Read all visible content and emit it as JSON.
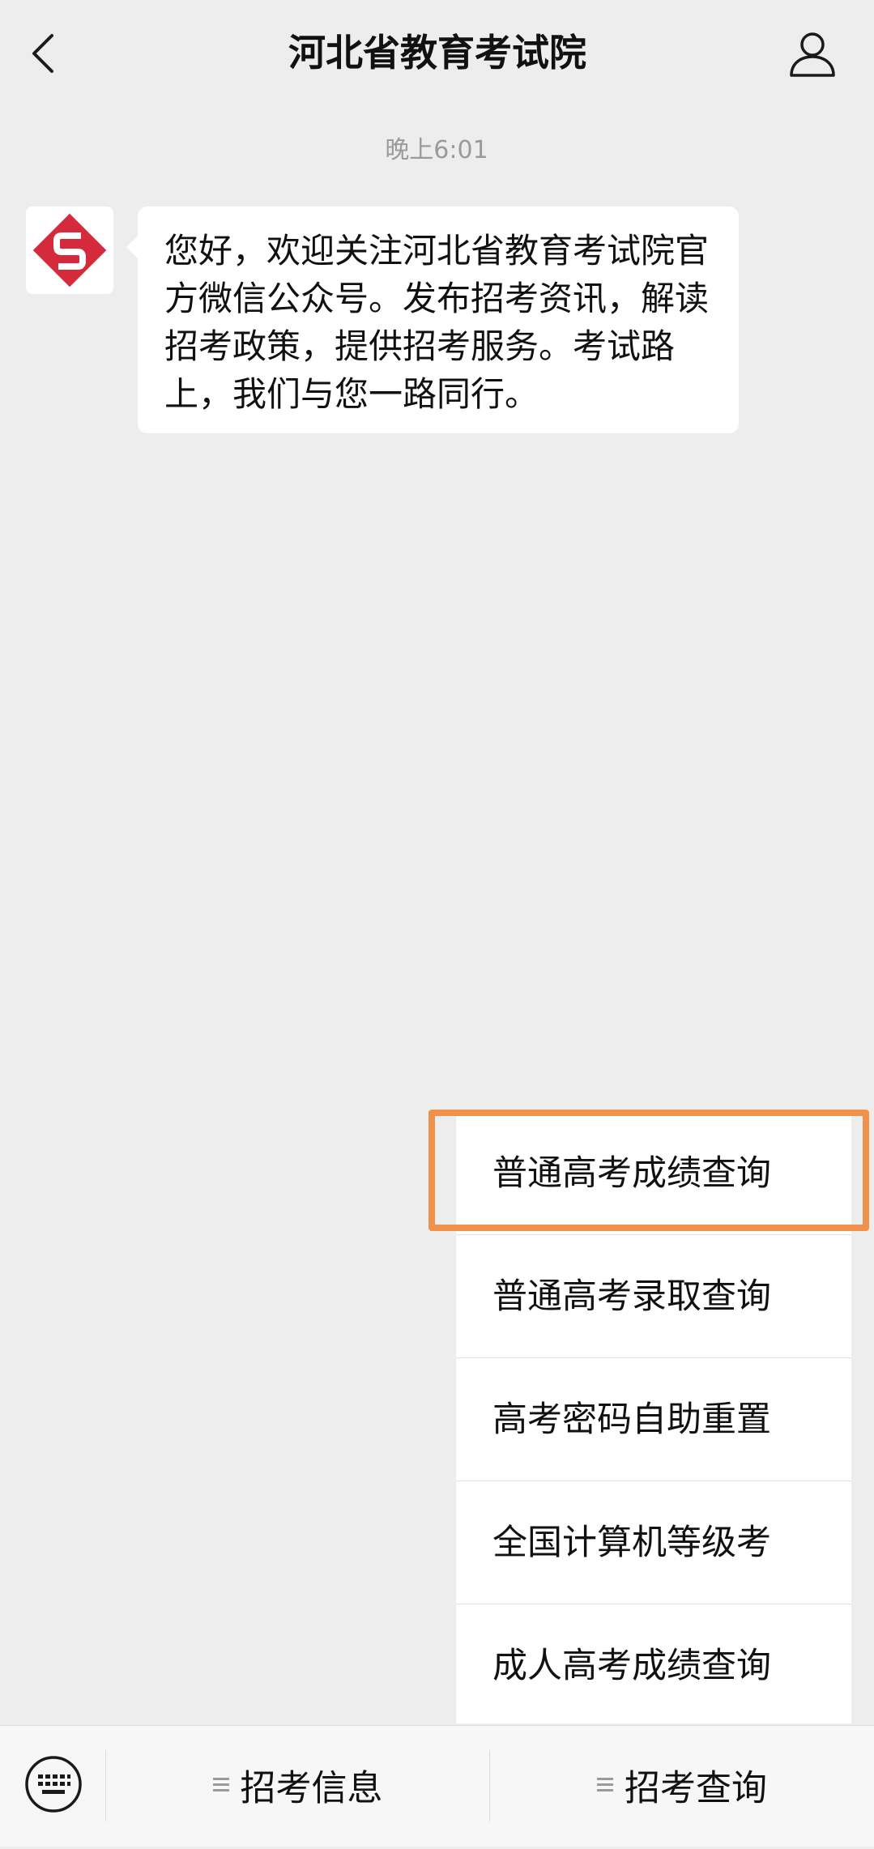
{
  "header": {
    "title": "河北省教育考试院"
  },
  "chat": {
    "timestamp": "晚上6:01",
    "message": "您好，欢迎关注河北省教育考试院官方微信公众号。发布招考资讯，解读招考政策，提供招考服务。考试路上，我们与您一路同行。"
  },
  "popup_menu": {
    "items": [
      {
        "label": "普通高考成绩查询",
        "highlighted": true
      },
      {
        "label": "普通高考录取查询"
      },
      {
        "label": "高考密码自助重置"
      },
      {
        "label": "全国计算机等级考"
      },
      {
        "label": "成人高考成绩查询"
      }
    ]
  },
  "bottom_bar": {
    "tabs": [
      {
        "label": "招考信息"
      },
      {
        "label": "招考查询"
      }
    ]
  },
  "colors": {
    "brand_red": "#d42a3c",
    "highlight_orange": "#f0924b",
    "background": "#ededed"
  },
  "icons": {
    "back": "chevron-left-icon",
    "profile": "person-icon",
    "keyboard": "keyboard-icon",
    "menu": "hamburger-icon"
  }
}
